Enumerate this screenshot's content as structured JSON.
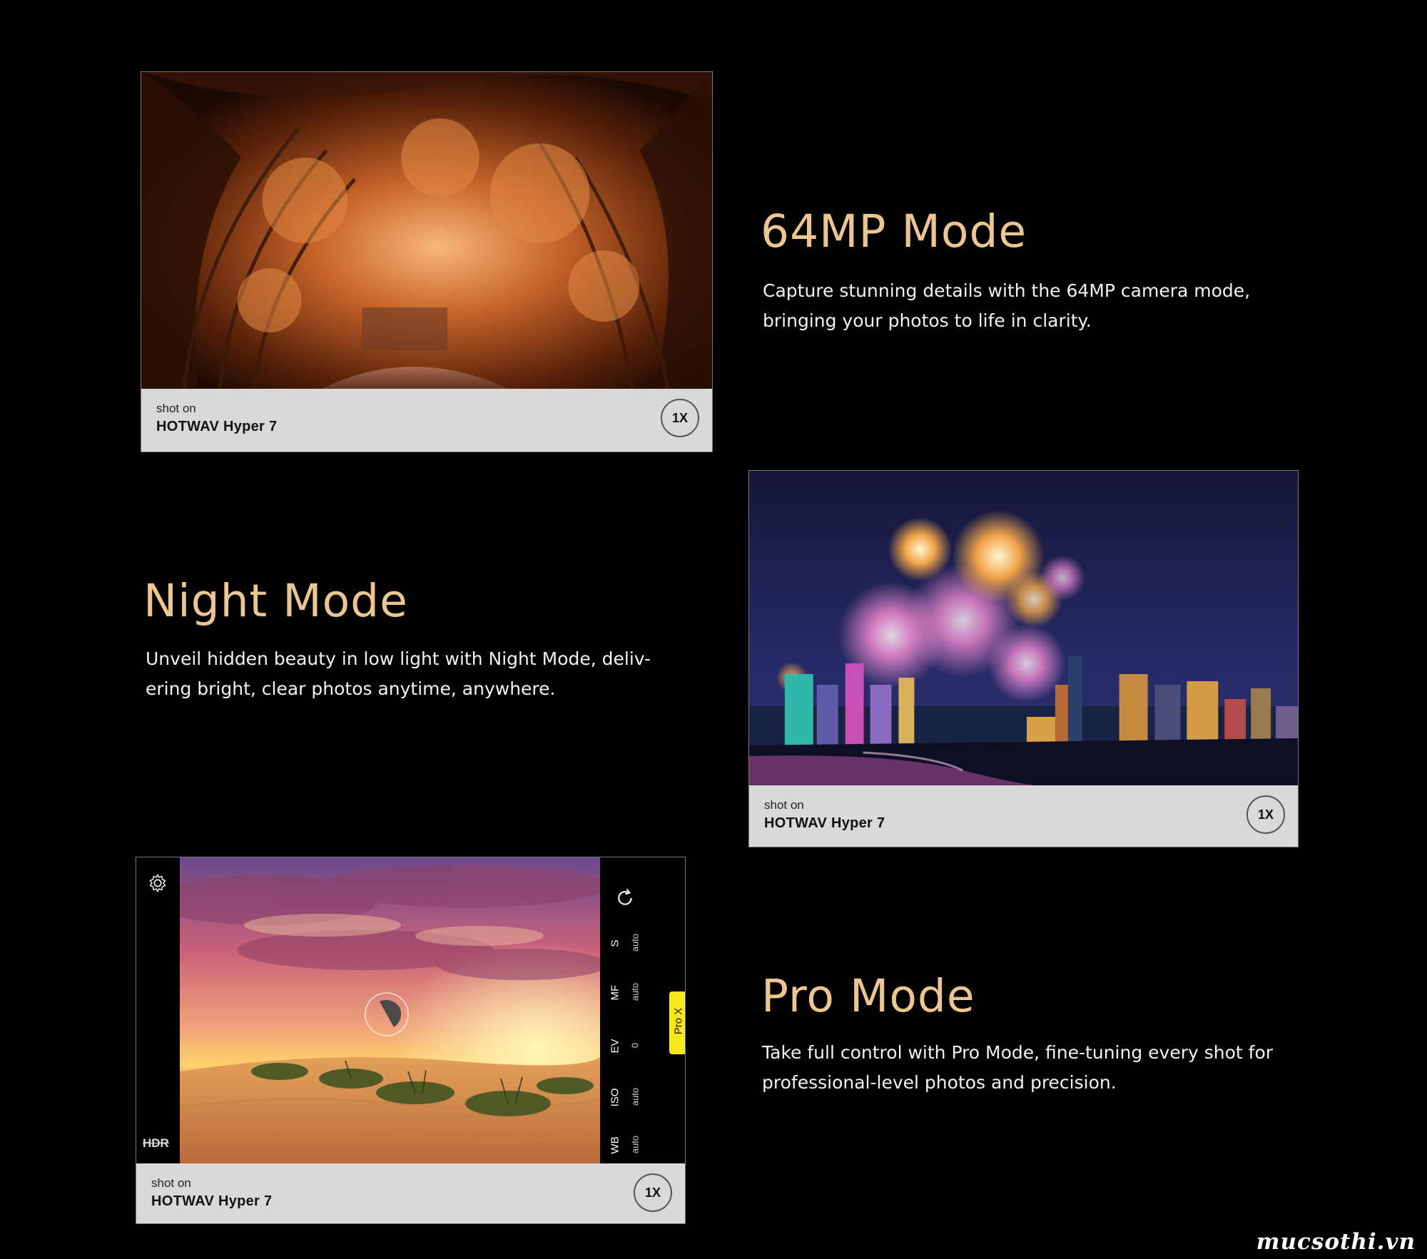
{
  "sections": {
    "mode_64mp": {
      "title": "64MP Mode",
      "description": "Capture stunning details with the 64MP camera mode, bringing your photos to life in clarity.",
      "card": {
        "shot_on": "shot on",
        "model": "HOTWAV Hyper 7",
        "zoom": "1X"
      }
    },
    "night_mode": {
      "title": "Night Mode",
      "description": "Unveil hidden beauty in low light with Night Mode, deliv-ering bright, clear photos anytime, anywhere.",
      "card": {
        "shot_on": "shot on",
        "model": "HOTWAV Hyper 7",
        "zoom": "1X"
      }
    },
    "pro_mode": {
      "title": "Pro Mode",
      "description": "Take full control with Pro Mode, fine-tuning every shot for professional-level photos and precision.",
      "card": {
        "shot_on": "shot on",
        "model": "HOTWAV Hyper 7",
        "zoom": "1X"
      },
      "camera_ui": {
        "hdr_label": "HDR",
        "pro_chip": "Pro X",
        "params": [
          {
            "label": "S",
            "value": "auto"
          },
          {
            "label": "MF",
            "value": "auto"
          },
          {
            "label": "EV",
            "value": "0"
          },
          {
            "label": "ISO",
            "value": "auto"
          },
          {
            "label": "WB",
            "value": "auto"
          }
        ]
      }
    }
  },
  "watermark": "mucsothi.vn",
  "colors": {
    "background": "#000000",
    "title_gold": "#ecc590",
    "caption_bg": "#d9d9d9",
    "pro_chip_yellow": "#f6e61b"
  },
  "icons": [
    "gear-icon",
    "refresh-icon",
    "focus-ring-icon"
  ]
}
